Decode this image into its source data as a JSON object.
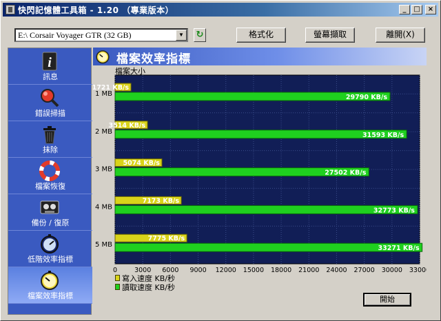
{
  "window": {
    "title": "快閃記憶體工具箱 - 1.20 （專業版本）",
    "min_label": "_",
    "max_label": "□",
    "close_label": "×"
  },
  "toolbar": {
    "device": "E:\\ Corsair Voyager GTR (32 GB)",
    "format_label": "格式化",
    "capture_label": "螢幕擷取",
    "exit_label": "離開(X)"
  },
  "sidebar": {
    "items": [
      {
        "label": "訊息",
        "icon": "info-icon"
      },
      {
        "label": "錯誤掃描",
        "icon": "magnifier-icon"
      },
      {
        "label": "抹除",
        "icon": "trash-icon"
      },
      {
        "label": "檔案恢復",
        "icon": "lifebuoy-icon"
      },
      {
        "label": "備份 / 復原",
        "icon": "tape-icon"
      },
      {
        "label": "低階效率指標",
        "icon": "stopwatch-icon"
      },
      {
        "label": "檔案效率指標",
        "icon": "stopwatch-icon"
      }
    ]
  },
  "panel": {
    "title": "檔案效率指標",
    "size_axis_label": "檔案大小",
    "legend_write": "寫入速度 KB/秒",
    "legend_read": "讀取速度 KB/秒",
    "start_label": "開始"
  },
  "colors": {
    "write": "#d9d31a",
    "read": "#1fd01f",
    "plot_bg": "#111e56",
    "sidebar": "#3a5ac0"
  },
  "chart_data": {
    "type": "bar",
    "orientation": "horizontal",
    "categories": [
      "1 MB",
      "2 MB",
      "3 MB",
      "4 MB",
      "5 MB"
    ],
    "series": [
      {
        "name": "寫入速度 KB/秒",
        "values": [
          1721,
          3514,
          5074,
          7173,
          7775
        ],
        "labels": [
          "1721 KB/s",
          "3514 KB/s",
          "5074 KB/s",
          "7173 KB/s",
          "7775 KB/s"
        ]
      },
      {
        "name": "讀取速度 KB/秒",
        "values": [
          29790,
          31593,
          27502,
          32773,
          33271
        ],
        "labels": [
          "29790 KB/s",
          "31593 KB/s",
          "27502 KB/s",
          "32773 KB/s",
          "33271 KB/s"
        ]
      }
    ],
    "xlim": [
      0,
      33000
    ],
    "xticks": [
      "0",
      "3000",
      "6000",
      "9000",
      "12000",
      "15000",
      "18000",
      "21000",
      "24000",
      "27000",
      "30000",
      "33000"
    ],
    "ylabel": "檔案大小",
    "grid": true,
    "legend": "bottom-left"
  }
}
